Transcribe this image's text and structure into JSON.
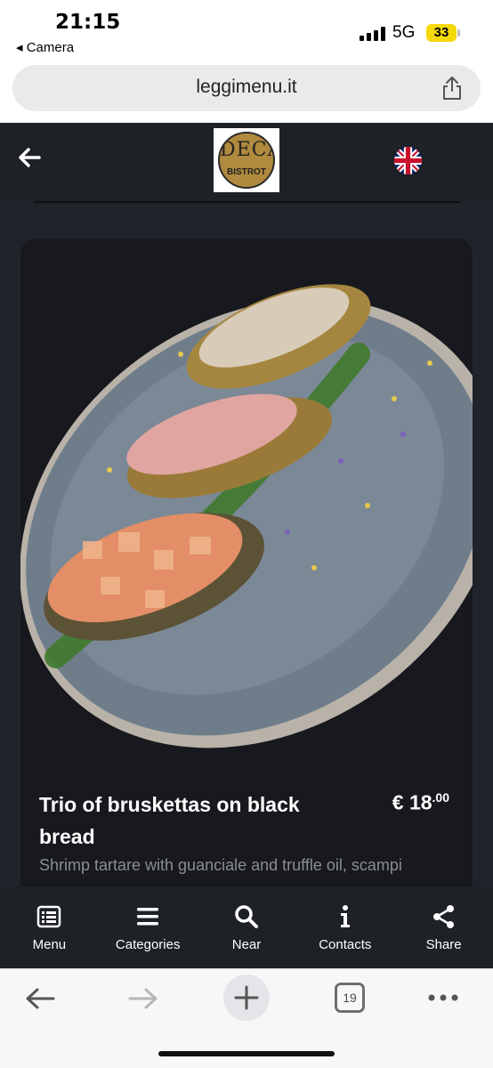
{
  "status_bar": {
    "time": "21:15",
    "back_app": "◂ Camera",
    "network": "5G",
    "battery": "33"
  },
  "browser": {
    "url": "leggimenu.it",
    "tabs_count": "19"
  },
  "header": {
    "logo_main": "DECA",
    "logo_sub": "BISTROT",
    "language_flag": "uk-flag-icon"
  },
  "dish": {
    "title": "Trio of bruskettas on black bread",
    "price_currency": "€",
    "price_main": "18",
    "price_cents": ".00",
    "description": "Shrimp tartare with guanciale and truffle oil, scampi"
  },
  "bottom_nav": [
    {
      "label": "Menu",
      "icon": "menu-list-icon"
    },
    {
      "label": "Categories",
      "icon": "hamburger-icon"
    },
    {
      "label": "Near",
      "icon": "search-icon"
    },
    {
      "label": "Contacts",
      "icon": "info-icon"
    },
    {
      "label": "Share",
      "icon": "share-icon"
    }
  ],
  "colors": {
    "header_bg": "#1e2126",
    "content_bg": "#20232a",
    "card_bg": "#17191e",
    "plate": "#6f7d8b"
  }
}
